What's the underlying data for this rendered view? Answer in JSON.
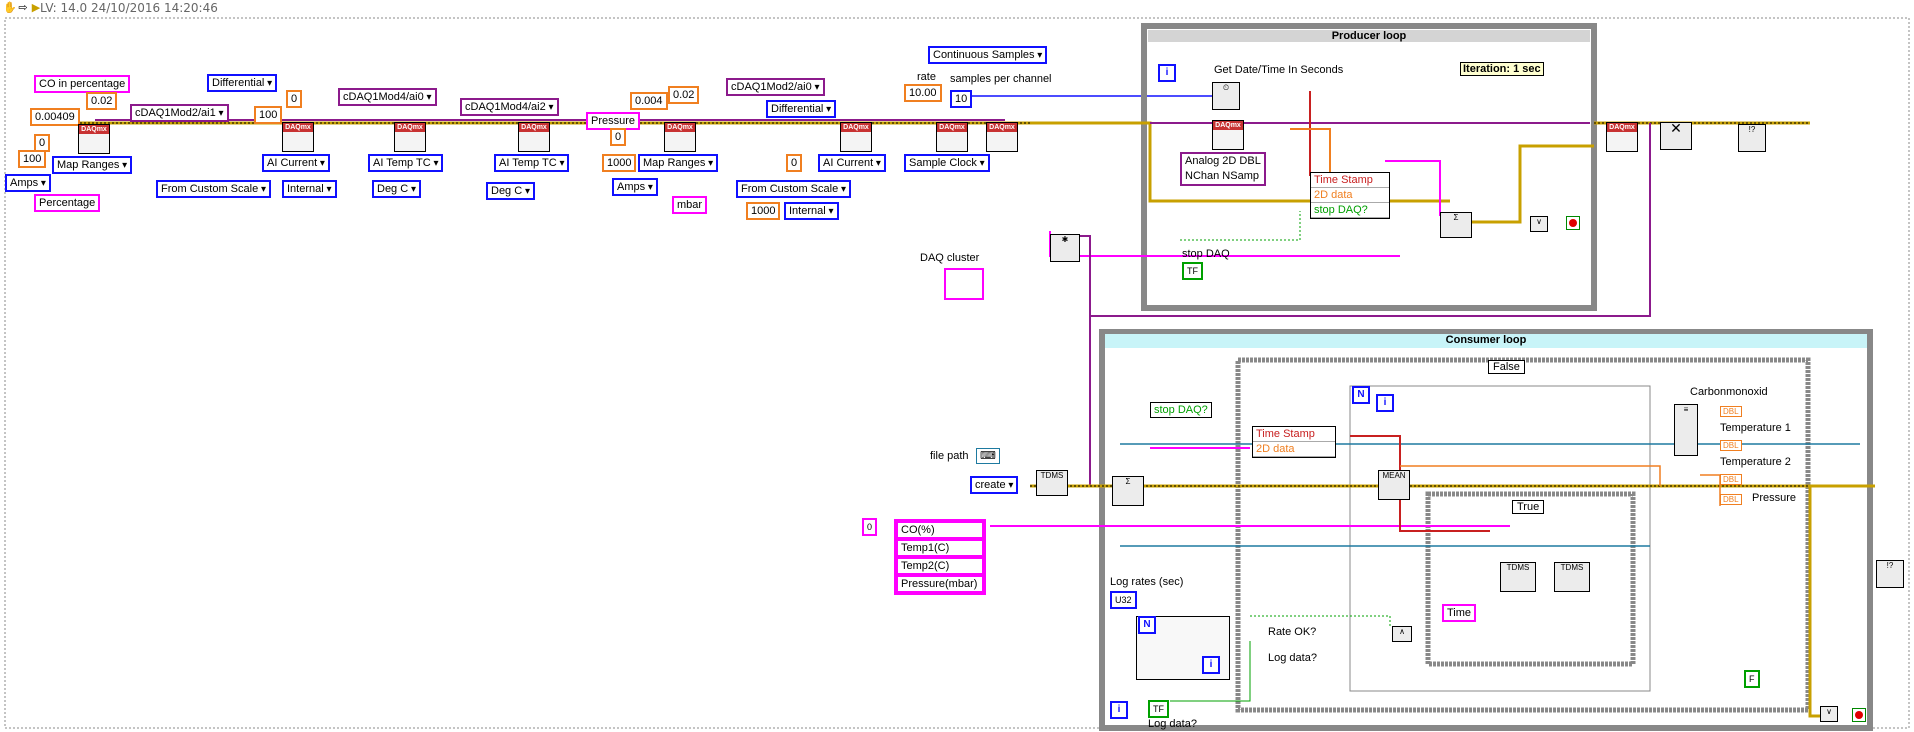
{
  "toolbar": {
    "title": "LV: 14.0 24/10/2016 14:20:46",
    "icons": [
      "hand-icon",
      "arrow-icon",
      "run-icon"
    ]
  },
  "config_chain": {
    "co_label": "CO in percentage",
    "const_0_02a": "0.02",
    "const_0_00409": "0.00409",
    "const_0a": "0",
    "const_100a": "100",
    "amps_a": "Amps",
    "map_ranges_a": "Map Ranges",
    "percentage": "Percentage",
    "chan_ai1": "cDAQ1Mod2/ai1",
    "differential_a": "Differential",
    "const_0b": "0",
    "const_100b": "100",
    "ai_current_a": "AI Current",
    "from_custom_scale_a": "From Custom Scale",
    "internal_a": "Internal",
    "chan_mod4_ai0": "cDAQ1Mod4/ai0",
    "ai_temp_tc_a": "AI Temp TC",
    "deg_c_a": "Deg C",
    "chan_mod4_ai2": "cDAQ1Mod4/ai2",
    "ai_temp_tc_b": "AI Temp TC",
    "deg_c_b": "Deg C",
    "pressure": "Pressure",
    "const_0_004": "0.004",
    "const_0_02b": "0.02",
    "const_0c": "0",
    "const_1000a": "1000",
    "map_ranges_b": "Map Ranges",
    "amps_b": "Amps",
    "mbar": "mbar",
    "chan_mod2_ai0": "cDAQ1Mod2/ai0",
    "differential_b": "Differential",
    "const_0d": "0",
    "ai_current_b": "AI Current",
    "from_custom_scale_b": "From Custom Scale",
    "const_1000b": "1000",
    "internal_b": "Internal",
    "continuous_samples": "Continuous Samples",
    "rate_label": "rate",
    "rate_value": "10.00",
    "samples_label": "samples per channel",
    "samples_value": "10",
    "sample_clock": "Sample Clock",
    "daq_cluster": "DAQ cluster"
  },
  "producer": {
    "title": "Producer loop",
    "get_date_time": "Get Date/Time In Seconds",
    "iteration": "Iteration: 1 sec",
    "analog_2d": "Analog 2D DBL",
    "nchan_nsamp": "NChan NSamp",
    "bundle": [
      "Time Stamp",
      "2D data",
      "stop DAQ?"
    ],
    "stop_daq_label": "stop DAQ",
    "tf": "TF"
  },
  "consumer": {
    "title": "Consumer loop",
    "case_false": "False",
    "case_true": "True",
    "stop_daq": "stop DAQ?",
    "unbundle": [
      "Time Stamp",
      "2D data"
    ],
    "mean": "MEAN",
    "file_path": "file path",
    "create": "create",
    "tdms": "TDMS",
    "array_index": "0",
    "channels": [
      "CO(%)",
      "Temp1(C)",
      "Temp2(C)",
      "Pressure(mbar)"
    ],
    "log_rates": "Log rates (sec)",
    "u32": "U32",
    "rate_ok": "Rate OK?",
    "log_data_q": "Log data?",
    "log_data_label": "Log data?",
    "tf": "TF",
    "time": "Time",
    "f_const": "F",
    "outputs": [
      "Carbonmonoxid",
      "Temperature 1",
      "Temperature 2",
      "Pressure"
    ],
    "dbl": "DBL"
  }
}
